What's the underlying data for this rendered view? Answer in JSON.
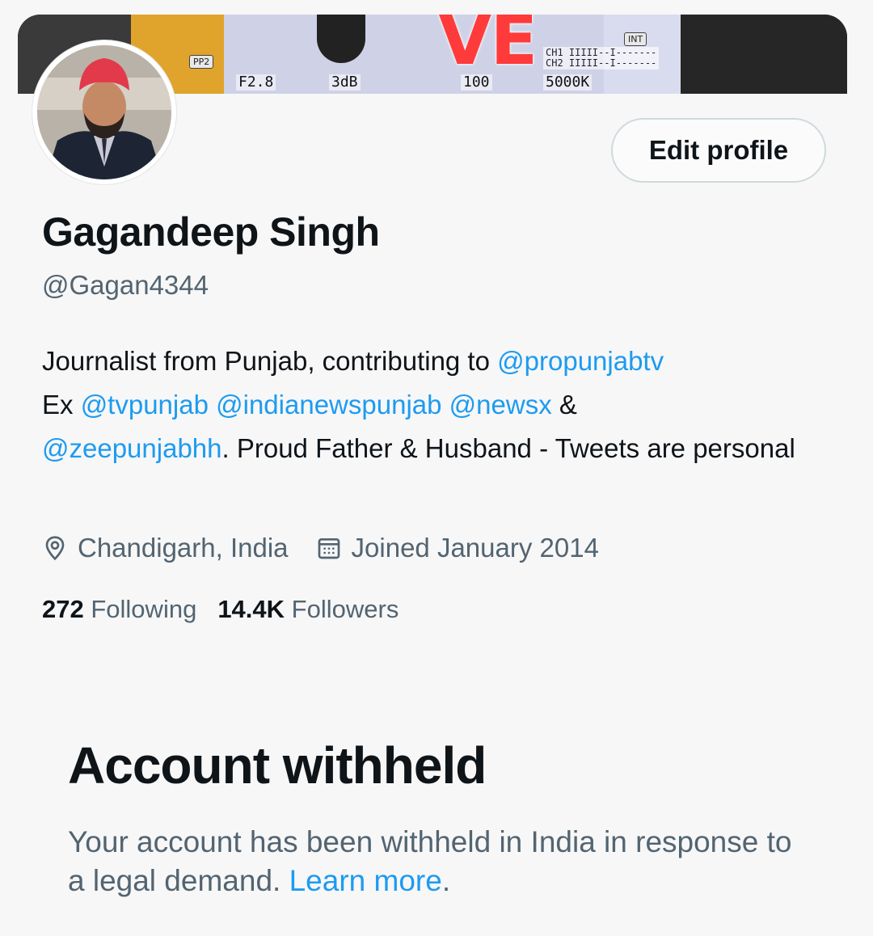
{
  "banner": {
    "big_text": "VE",
    "osd_f": "F2.8",
    "osd_db": "3dB",
    "osd_100": "100",
    "osd_k": "5000K",
    "osd_pp2": "PP2",
    "osd_ch1": "CH1 IIIII--I-------",
    "osd_ch2": "CH2 IIIII--I-------",
    "osd_int": "INT"
  },
  "profile": {
    "edit_label": "Edit profile",
    "name": "Gagandeep Singh",
    "handle": "@Gagan4344",
    "bio": {
      "t1": "Journalist from Punjab, contributing to ",
      "m1": "@propunjabtv",
      "t2": "Ex ",
      "m2": "@tvpunjab",
      "sp1": " ",
      "m3": "@indianewspunjab",
      "sp2": " ",
      "m4": "@newsx",
      "t3": " &",
      "m5": "@zeepunjabhh",
      "t4": ". Proud Father & Husband - Tweets are personal"
    },
    "location": "Chandigarh, India",
    "joined": "Joined January 2014",
    "following_count": "272",
    "following_label": "Following",
    "followers_count": "14.4K",
    "followers_label": "Followers"
  },
  "withheld": {
    "title": "Account withheld",
    "text": "Your account has been withheld in India in response to a legal demand. ",
    "link": "Learn more",
    "end": "."
  },
  "colors": {
    "accent": "#1d9bf0",
    "secondary_text": "#536471",
    "primary_text": "#0f1419"
  }
}
